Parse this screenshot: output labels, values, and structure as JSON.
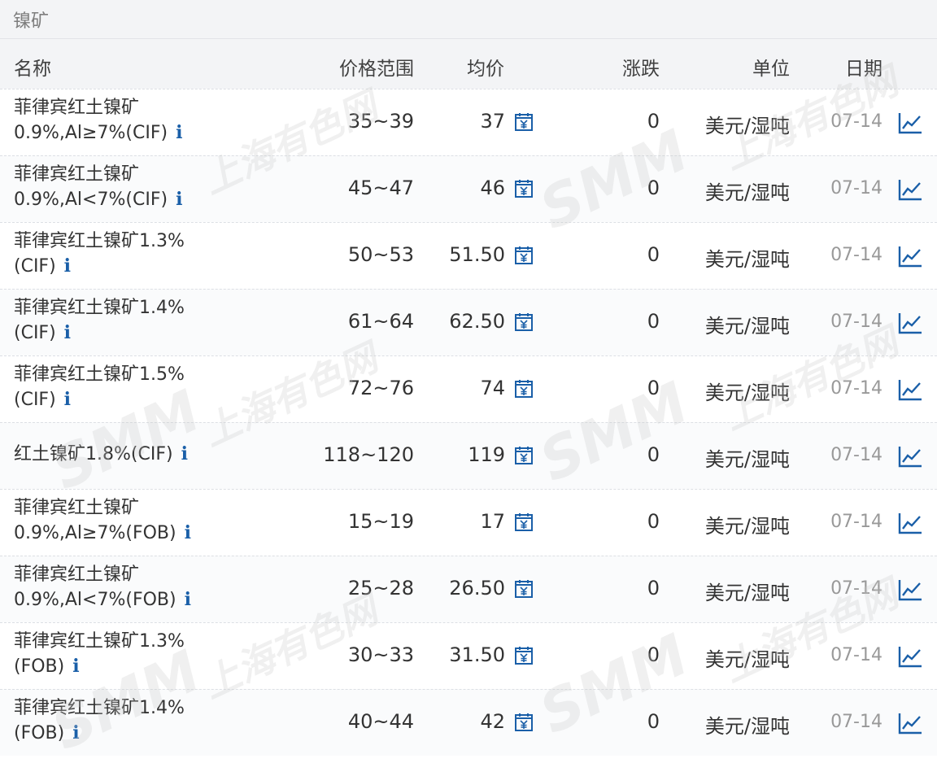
{
  "section_title": "镍矿",
  "columns": {
    "name": "名称",
    "range": "价格范围",
    "avg": "均价",
    "change": "涨跌",
    "unit": "单位",
    "date": "日期"
  },
  "rows": [
    {
      "name_line1": "菲律宾红土镍矿",
      "name_line2": "0.9%,Al≥7%(CIF)",
      "range": "35~39",
      "avg": "37",
      "change": "0",
      "unit": "美元/湿吨",
      "date": "07-14"
    },
    {
      "name_line1": "菲律宾红土镍矿",
      "name_line2": "0.9%,Al<7%(CIF)",
      "range": "45~47",
      "avg": "46",
      "change": "0",
      "unit": "美元/湿吨",
      "date": "07-14"
    },
    {
      "name_line1": "菲律宾红土镍矿1.3%",
      "name_line2": "(CIF)",
      "range": "50~53",
      "avg": "51.50",
      "change": "0",
      "unit": "美元/湿吨",
      "date": "07-14"
    },
    {
      "name_line1": "菲律宾红土镍矿1.4%",
      "name_line2": "(CIF)",
      "range": "61~64",
      "avg": "62.50",
      "change": "0",
      "unit": "美元/湿吨",
      "date": "07-14"
    },
    {
      "name_line1": "菲律宾红土镍矿1.5%",
      "name_line2": "(CIF)",
      "range": "72~76",
      "avg": "74",
      "change": "0",
      "unit": "美元/湿吨",
      "date": "07-14"
    },
    {
      "name_line1": "红土镍矿1.8%(CIF)",
      "name_line2": "",
      "range": "118~120",
      "avg": "119",
      "change": "0",
      "unit": "美元/湿吨",
      "date": "07-14"
    },
    {
      "name_line1": "菲律宾红土镍矿",
      "name_line2": "0.9%,Al≥7%(FOB)",
      "range": "15~19",
      "avg": "17",
      "change": "0",
      "unit": "美元/湿吨",
      "date": "07-14"
    },
    {
      "name_line1": "菲律宾红土镍矿",
      "name_line2": "0.9%,Al<7%(FOB)",
      "range": "25~28",
      "avg": "26.50",
      "change": "0",
      "unit": "美元/湿吨",
      "date": "07-14"
    },
    {
      "name_line1": "菲律宾红土镍矿1.3%",
      "name_line2": "(FOB)",
      "range": "30~33",
      "avg": "31.50",
      "change": "0",
      "unit": "美元/湿吨",
      "date": "07-14"
    },
    {
      "name_line1": "菲律宾红土镍矿1.4%",
      "name_line2": "(FOB)",
      "range": "40~44",
      "avg": "42",
      "change": "0",
      "unit": "美元/湿吨",
      "date": "07-14"
    }
  ],
  "info_label": "i",
  "watermark": {
    "cn": "上海有色网",
    "en": "SMM"
  },
  "colors": {
    "accent": "#1a5fa8",
    "header_bg": "#f3f4f6",
    "date_text": "#999999"
  },
  "icons": {
    "avg_action": "calendar-icon",
    "trend_action": "line-chart-icon",
    "info": "info-icon"
  }
}
